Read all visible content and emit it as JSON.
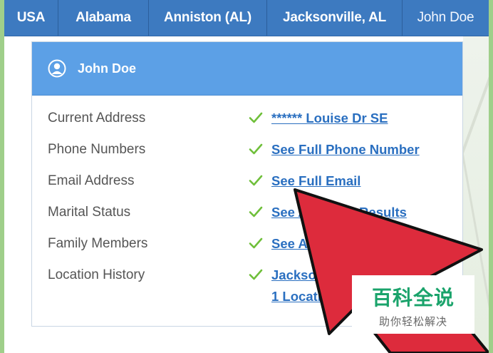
{
  "breadcrumb": {
    "items": [
      {
        "label": "USA"
      },
      {
        "label": "Alabama"
      },
      {
        "label": "Anniston (AL)"
      },
      {
        "label": "Jacksonville, AL"
      },
      {
        "label": "John Doe"
      }
    ]
  },
  "panel": {
    "title": "John Doe",
    "rows": [
      {
        "label": "Current Address",
        "link": "****** Louise Dr SE"
      },
      {
        "label": "Phone Numbers",
        "link": "See Full Phone Number"
      },
      {
        "label": "Email Address",
        "link": "See Full Email"
      },
      {
        "label": "Marital Status",
        "link": "See Available Results"
      },
      {
        "label": "Family Members",
        "link": "See Available Results"
      },
      {
        "label": "Location History",
        "link": "Jacksonville, AL",
        "link2": "1 Location Found"
      }
    ]
  },
  "colors": {
    "breadcrumb_bg": "#3d7ac0",
    "header_bg": "#5ca0e6",
    "link": "#2a6fc0",
    "check": "#6fbf3a",
    "arrow": "#dd2b3c",
    "watermark_text": "#1aa36b"
  },
  "icons": {
    "header": "user-circle-icon",
    "row": "checkmark-icon",
    "annotation": "arrow-pointer"
  },
  "watermark": {
    "title": "百科全说",
    "subtitle": "助你轻松解决"
  }
}
